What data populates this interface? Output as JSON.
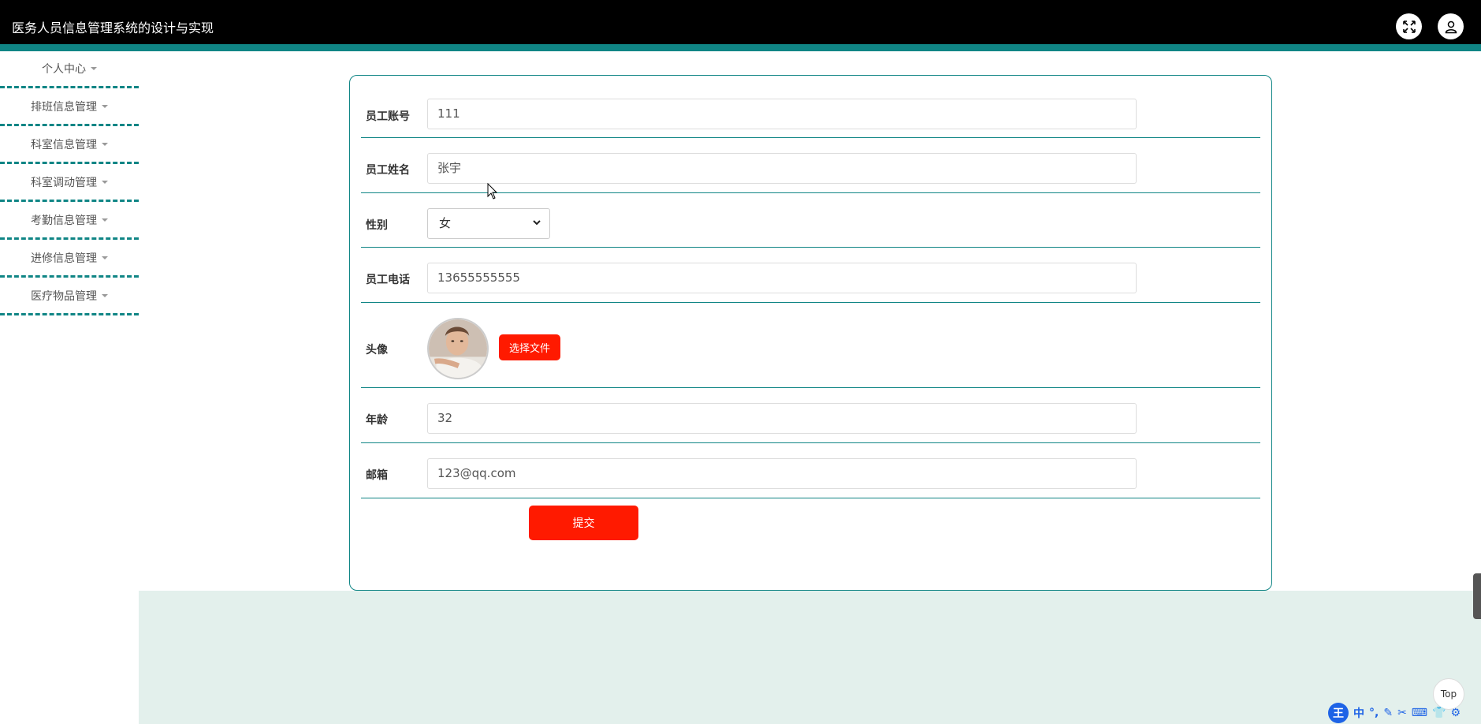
{
  "header": {
    "title": "医务人员信息管理系统的设计与实现",
    "fullscreen_icon": "fullscreen-icon",
    "user_icon": "user-icon"
  },
  "sidebar": {
    "items": [
      {
        "label": "个人中心"
      },
      {
        "label": "排班信息管理"
      },
      {
        "label": "科室信息管理"
      },
      {
        "label": "科室调动管理"
      },
      {
        "label": "考勤信息管理"
      },
      {
        "label": "进修信息管理"
      },
      {
        "label": "医疗物品管理"
      }
    ]
  },
  "form": {
    "account": {
      "label": "员工账号",
      "value": "111"
    },
    "name": {
      "label": "员工姓名",
      "value": "张宇"
    },
    "gender": {
      "label": "性别",
      "value": "女"
    },
    "phone": {
      "label": "员工电话",
      "value": "13655555555"
    },
    "avatar": {
      "label": "头像",
      "button": "选择文件"
    },
    "age": {
      "label": "年龄",
      "value": "32"
    },
    "email": {
      "label": "邮箱",
      "value": "123@qq.com"
    },
    "submit": "提交"
  },
  "widgets": {
    "top_button": "Top",
    "ime_logo": "王",
    "ime_lang": "中"
  },
  "colors": {
    "accent": "#108585",
    "button": "#ff1a00",
    "header_bg": "#000000",
    "bottom_bg": "#e3f0ec"
  }
}
